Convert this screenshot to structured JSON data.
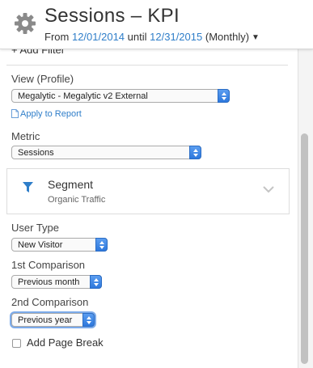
{
  "header": {
    "title": "Sessions – KPI",
    "from_label": "From",
    "start_date": "12/01/2014",
    "until_label": "until",
    "end_date": "12/31/2015",
    "interval": "(Monthly)",
    "icon": "gear-icon"
  },
  "filters": {
    "add_filter_label": "+ Add Filter"
  },
  "view": {
    "label": "View (Profile)",
    "selected": "Megalytic - Megalytic v2 External",
    "apply_link": "Apply to Report"
  },
  "metric": {
    "label": "Metric",
    "selected": "Sessions"
  },
  "segment": {
    "title": "Segment",
    "value": "Organic Traffic",
    "icon": "funnel-icon",
    "icon_color": "#2f7ec9"
  },
  "user_type": {
    "label": "User Type",
    "selected": "New Visitor"
  },
  "first_comparison": {
    "label": "1st Comparison",
    "selected": "Previous month"
  },
  "second_comparison": {
    "label": "2nd Comparison",
    "selected": "Previous year"
  },
  "page_break": {
    "label": "Add Page Break",
    "checked": false
  },
  "colors": {
    "accent": "#2f7ec9",
    "select_arrow": "#2d78dd"
  }
}
